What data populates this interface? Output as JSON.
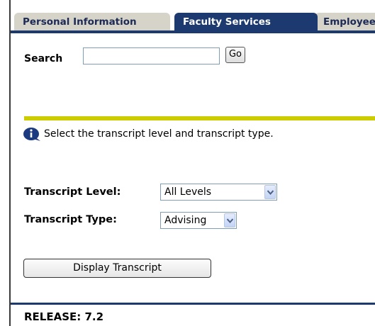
{
  "tabs": [
    {
      "label": "Personal Information"
    },
    {
      "label": "Faculty Services"
    },
    {
      "label": "Employee"
    }
  ],
  "search": {
    "label": "Search",
    "value": "",
    "go_label": "Go"
  },
  "info": {
    "icon": "info-icon",
    "message": "Select the transcript level and transcript type."
  },
  "form": {
    "level_label": "Transcript Level:",
    "level_value": "All Levels",
    "type_label": "Transcript Type:",
    "type_value": "Advising",
    "submit_label": "Display Transcript"
  },
  "footer": {
    "release": "RELEASE: 7.2"
  },
  "colors": {
    "tab_active": "#1c3a70",
    "tab_inactive": "#d6d3c9",
    "rule": "#cdcc00"
  }
}
